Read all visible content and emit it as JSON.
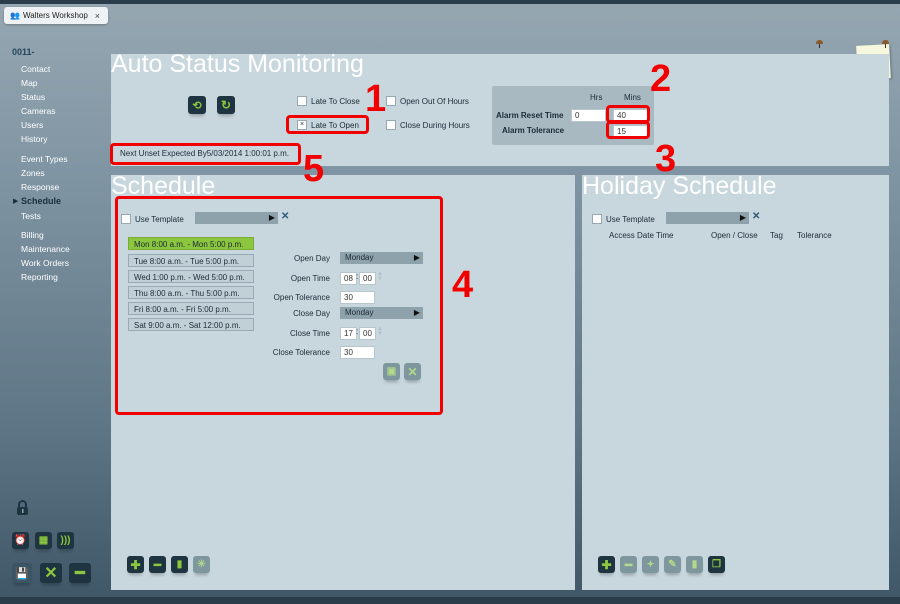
{
  "tab": {
    "title": "Walters Workshop",
    "icon": "users-icon",
    "close": "×"
  },
  "nav": {
    "account": "0011-",
    "items": [
      {
        "label": "Contact"
      },
      {
        "label": "Map"
      },
      {
        "label": "Status"
      },
      {
        "label": "Cameras"
      },
      {
        "label": "Users"
      },
      {
        "label": "History"
      },
      {
        "label": "Event Types"
      },
      {
        "label": "Zones"
      },
      {
        "label": "Response"
      },
      {
        "label": "Schedule",
        "active": true
      },
      {
        "label": "Tests"
      },
      {
        "label": "Billing"
      },
      {
        "label": "Maintenance"
      },
      {
        "label": "Work Orders"
      },
      {
        "label": "Reporting"
      }
    ]
  },
  "auto_status": {
    "title": "Auto Status Monitoring",
    "checkboxes": {
      "late_to_close": {
        "label": "Late To Close",
        "checked": false
      },
      "late_to_open": {
        "label": "Late To Open",
        "checked": true,
        "mark": "×"
      },
      "open_out_of_hours": {
        "label": "Open Out Of Hours",
        "checked": false
      },
      "close_during_hours": {
        "label": "Close During Hours",
        "checked": false
      }
    },
    "alarm": {
      "hrs_header": "Hrs",
      "mins_header": "Mins",
      "reset_label": "Alarm Reset Time",
      "reset_hrs": "0",
      "reset_mins": "40",
      "tolerance_label": "Alarm Tolerance",
      "tolerance_mins": "15"
    },
    "next_unset": "Next Unset Expected By5/03/2014 1:00:01 p.m."
  },
  "schedule": {
    "title": "Schedule",
    "use_template_label": "Use Template",
    "template_value": "",
    "slots": [
      {
        "label": "Mon 8:00 a.m. - Mon 5:00 p.m.",
        "selected": true
      },
      {
        "label": "Tue 8:00 a.m. - Tue 5:00 p.m."
      },
      {
        "label": "Wed 1:00 p.m. - Wed 5:00 p.m."
      },
      {
        "label": "Thu 8:00 a.m. - Thu 5:00 p.m."
      },
      {
        "label": "Fri 8:00 a.m. - Fri 5:00 p.m."
      },
      {
        "label": "Sat 9:00 a.m. - Sat 12:00 p.m."
      }
    ],
    "form": {
      "open_day_label": "Open Day",
      "open_day": "Monday",
      "open_time_label": "Open Time",
      "open_hh": "08",
      "open_mm": "00",
      "open_tol_label": "Open Tolerance",
      "open_tol": "30",
      "close_day_label": "Close Day",
      "close_day": "Monday",
      "close_time_label": "Close Time",
      "close_hh": "17",
      "close_mm": "00",
      "close_tol_label": "Close Tolerance",
      "close_tol": "30"
    }
  },
  "holiday": {
    "title": "Holiday Schedule",
    "use_template_label": "Use Template",
    "columns": [
      "Access Date Time",
      "Open / Close",
      "Tag",
      "Tolerance"
    ]
  },
  "annotations": [
    "1",
    "2",
    "3",
    "4",
    "5"
  ],
  "colors": {
    "accent": "#8cc63f",
    "annotation": "#f20000",
    "panel": "#c8d7de",
    "button": "#1e3441"
  }
}
